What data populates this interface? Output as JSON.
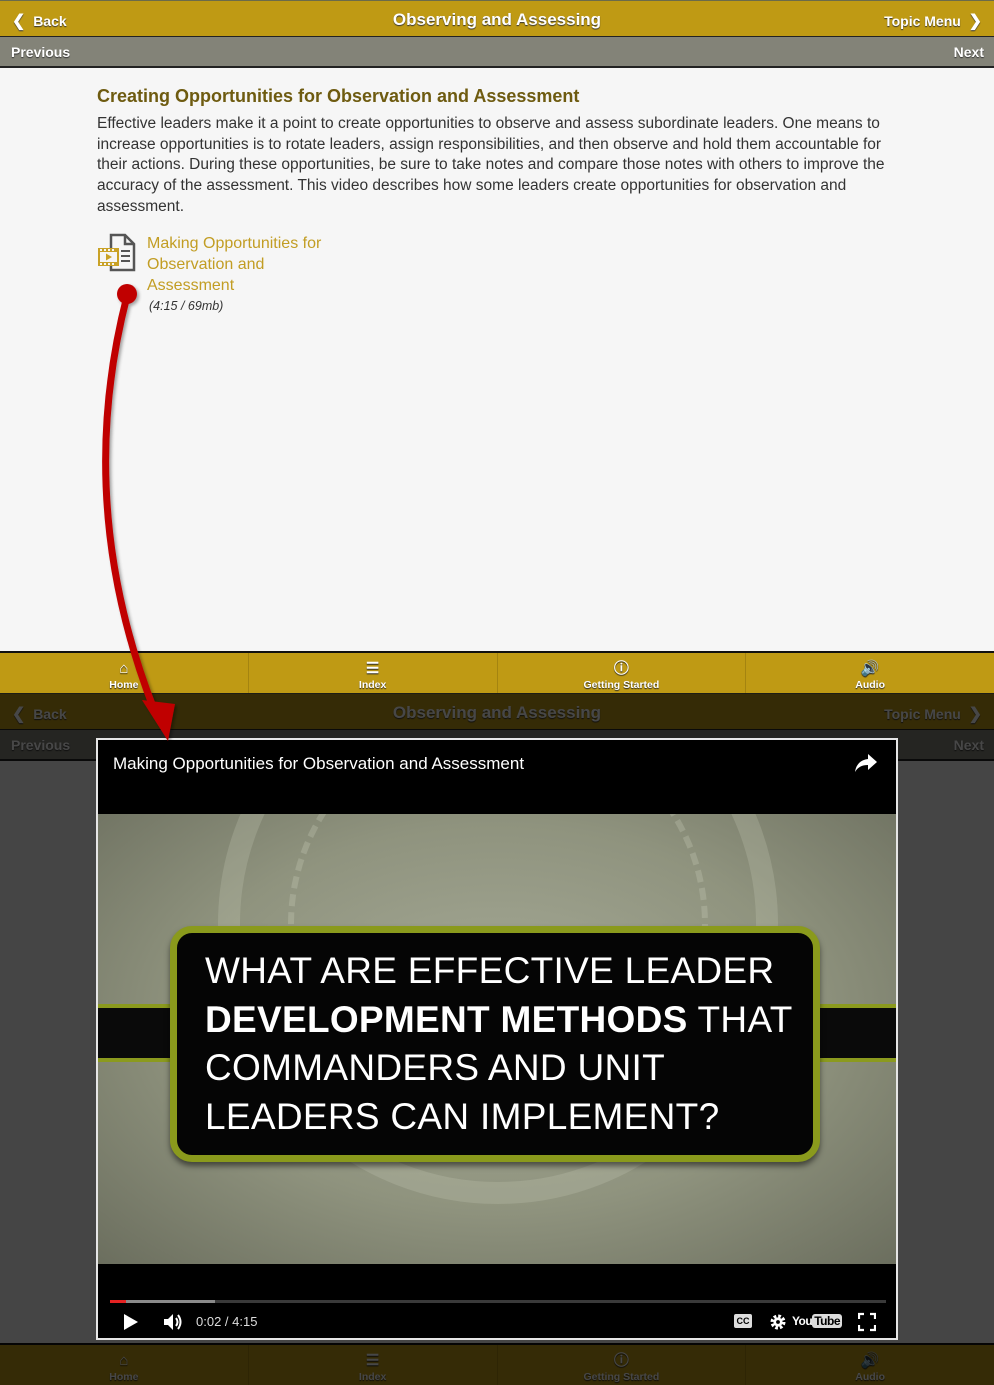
{
  "header": {
    "back_label": "Back",
    "title": "Observing and Assessing",
    "topic_menu_label": "Topic Menu",
    "previous_label": "Previous",
    "next_label": "Next"
  },
  "content": {
    "heading": "Creating Opportunities for Observation and Assessment",
    "body": "Effective leaders make it a point to create opportunities to observe and assess subordinate leaders. One means to increase opportunities is to rotate leaders, assign responsibilities, and then observe and hold them accountable for their actions. During these opportunities, be sure to take notes and compare those notes with others to improve the accuracy of the assessment. This video describes how some leaders create opportunities for observation and assessment.",
    "media_link": {
      "icon": "video-document-icon",
      "label": "Making Opportunities for Observation and Assessment",
      "meta": "(4:15 / 69mb)"
    }
  },
  "footer_nav": [
    {
      "label": "Home",
      "icon": "home-icon"
    },
    {
      "label": "Index",
      "icon": "list-icon"
    },
    {
      "label": "Getting Started",
      "icon": "info-icon"
    },
    {
      "label": "Audio",
      "icon": "speaker-icon"
    }
  ],
  "video_player": {
    "title": "Making Opportunities for Observation and Assessment",
    "frame_text": {
      "line1": "WHAT ARE EFFECTIVE LEADER",
      "line2_bold": "DEVELOPMENT METHODS",
      "line2_rest": " THAT",
      "line3": "COMMANDERS AND UNIT",
      "line4": "LEADERS CAN IMPLEMENT?"
    },
    "current_time": "0:02",
    "duration": "4:15",
    "time_display": "0:02 / 4:15",
    "played_fraction": 0.008,
    "buffered_fraction": 0.135,
    "cc_label": "CC",
    "youtube_label_you": "You",
    "youtube_label_tube": "Tube"
  },
  "colors": {
    "brand_gold": "#bf9a14",
    "subheader_gray": "#838378",
    "heading_brown": "#6e5b10",
    "link_gold": "#c29d23",
    "annotation_arrow": "#c00000",
    "progress_red": "#e52222"
  }
}
